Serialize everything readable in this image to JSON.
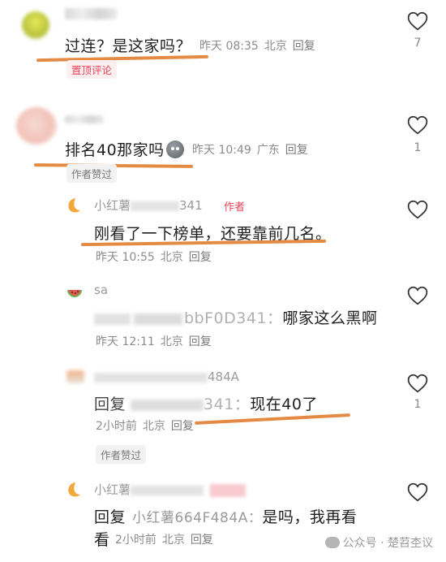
{
  "comments": [
    {
      "text": "过连？是这家吗？",
      "time": "昨天 08:35",
      "location": "北京",
      "reply_label": "回复",
      "likes": "7",
      "badge": "置顶评论"
    },
    {
      "text": "排名40那家吗",
      "emoji": "poop-emoji",
      "time": "昨天 10:49",
      "location": "广东",
      "reply_label": "回复",
      "likes": "1",
      "badge": "作者赞过"
    },
    {
      "name": "小红薯",
      "name_suffix": "341",
      "author_tag": "作者",
      "text": "刚看了一下榜单，还要靠前几名。",
      "time": "昨天 10:55",
      "location": "北京",
      "reply_label": "回复"
    },
    {
      "name": "sa",
      "reply_target_suffix": "bbF0D341：",
      "text": "哪家这么黑啊",
      "time": "昨天 12:11",
      "location": "北京",
      "reply_label": "回复"
    },
    {
      "name_suffix": "484A",
      "reply_prefix": "回复",
      "reply_target_suffix": "341：",
      "text": "现在40了",
      "time": "2小时前",
      "location": "北京",
      "reply_label": "回复",
      "likes": "1",
      "badge": "作者赞过"
    },
    {
      "name": "小红薯",
      "reply_prefix": "回复",
      "reply_target": "小红薯664F484A：",
      "text": "是吗，我再看",
      "text_cont": "看",
      "time": "2小时前",
      "location": "北京",
      "reply_label": "回复"
    }
  ],
  "watermark": "公众号 · 楚苕杢议",
  "colors": {
    "underline": "#e2843a",
    "accent": "#e8455a"
  }
}
